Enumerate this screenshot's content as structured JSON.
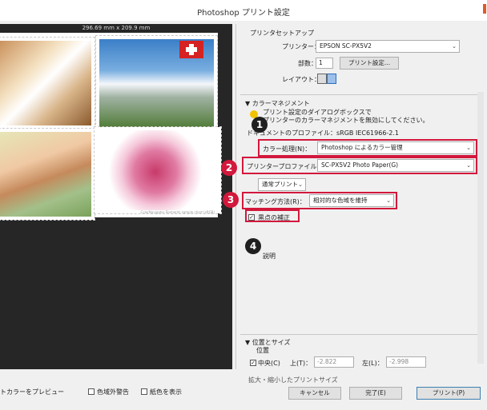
{
  "window": {
    "title": "Photoshop プリント設定"
  },
  "preview": {
    "paper_size": "296.69 mm x 209.9 mm",
    "watermark": "ColorNavigator Elements sample chart (sRGB)"
  },
  "print_setup": {
    "heading": "プリンタセットアップ",
    "printer_label": "プリンター：",
    "printer_value": "EPSON SC-PX5V2",
    "copies_label": "部数：",
    "copies_value": "1",
    "print_settings_button": "プリント設定...",
    "layout_label": "レイアウト："
  },
  "color_management": {
    "heading": "カラーマネジメント",
    "note_line1": "プリント設定のダイアログボックスで",
    "note_line2": "プリンターのカラーマネジメントを無効にしてください。",
    "doc_profile": "ドキュメントのプロファイル：sRGB IEC61966-2.1",
    "color_handling_label": "カラー処理(N)：",
    "color_handling_value": "Photoshop によるカラー管理",
    "printer_profile_label": "プリンタープロファイル(P)：",
    "printer_profile_value": "SC-PX5V2 Photo Paper(G)",
    "print_mode_value": "通常プリント",
    "matching_label": "マッチング方法(R)：",
    "matching_value": "相対的な色域を維持",
    "bpc_label": "黒点の補正",
    "bpc_checked": true,
    "description_label": "説明"
  },
  "position_size": {
    "heading": "位置とサイズ",
    "position_label": "位置",
    "center_label": "中央(C)",
    "center_checked": true,
    "top_label": "上(T)：",
    "top_value": "-2.822",
    "left_label": "左(L)：",
    "left_value": "-2.998",
    "scaled_label": "拡大・縮小したプリントサイズ"
  },
  "footer": {
    "preview_match_label": "トカラーをプレビュー",
    "gamut_warning_label": "色域外警告",
    "show_paper_white_label": "紙色を表示",
    "cancel_button": "キャンセル",
    "done_button": "完了(E)",
    "print_button": "プリント(P)"
  },
  "badges": {
    "b1": "1",
    "b2": "2",
    "b3": "3",
    "b4": "4"
  },
  "colors": {
    "highlight": "#d2183c",
    "preview_bg": "#262626"
  }
}
